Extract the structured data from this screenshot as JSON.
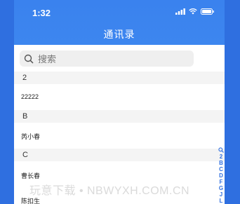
{
  "status_bar": {
    "time": "1:32"
  },
  "header": {
    "title": "通讯录"
  },
  "search": {
    "placeholder": "搜索"
  },
  "sections": [
    {
      "letter": "2",
      "contacts": [
        "22222"
      ]
    },
    {
      "letter": "B",
      "contacts": [
        "芮小春"
      ]
    },
    {
      "letter": "C",
      "contacts": [
        "曹长春",
        "陈扣生"
      ]
    }
  ],
  "index_bar": {
    "letters": [
      "2",
      "B",
      "C",
      "D",
      "F",
      "G",
      "J",
      "L"
    ]
  },
  "watermark": "玩意下载 • NBWYXH.COM.CN",
  "colors": {
    "header_blue": "#3a82ee",
    "frame_blue": "#2f6fe0",
    "section_bg": "#f4f4f4",
    "search_bg": "#efefef"
  }
}
